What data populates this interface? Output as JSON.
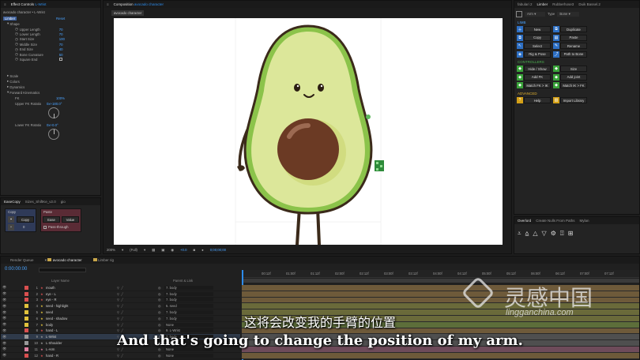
{
  "effect_controls": {
    "tab_label": "Effect Controls",
    "tab_target": "L-Wrist",
    "breadcrumb": "avocado character • L-Wrist",
    "limber_label": "Limber",
    "reset_label": "Reset",
    "shape_label": "Shape",
    "params": [
      {
        "name": "Upper Length",
        "value": "70"
      },
      {
        "name": "Lower Length",
        "value": "70"
      },
      {
        "name": "Start Size",
        "value": "100"
      },
      {
        "name": "Middle Size",
        "value": "70"
      },
      {
        "name": "End Size",
        "value": "40"
      },
      {
        "name": "Bone Curvature",
        "value": "50"
      },
      {
        "name": "Square End",
        "value": ""
      }
    ],
    "sections": [
      "Scale",
      "Colors",
      "Dynamics"
    ],
    "fk_label": "Forward Kinematics",
    "fk_params": [
      {
        "name": "FK",
        "value": "100%"
      },
      {
        "name": "Upper FK Rotatio",
        "value": "0x+180.0°"
      },
      {
        "name": "Lower FK Rotatio",
        "value": "0x+0.0°"
      }
    ]
  },
  "bottom_left": {
    "tabs": [
      "EaseCopy",
      "Sizes_ShiftKe_v2.0",
      "gio"
    ],
    "copy_label": "Copy",
    "copy_btn": "Copy",
    "paste_label": "Paste",
    "ease_btn": "Ease",
    "value_btn": "Value",
    "num": "0",
    "passthrough": "Pass-through"
  },
  "composition": {
    "tab_label": "Composition",
    "tab_target": "avocado character",
    "subtab": "avocado character",
    "zoom": "200%",
    "quality": "(Full)",
    "exposure": "+0.0",
    "timecode": "0;00;00;00"
  },
  "limber": {
    "tabs": [
      "fabulari 2",
      "Limber",
      "Rubberhose3",
      "Duik Bassel.2"
    ],
    "arm_label": "Arm",
    "type_label": "Type",
    "type_value": "Bone",
    "limb_section": "LIMB",
    "buttons": [
      [
        "New",
        "Duplicate"
      ],
      [
        "Copy",
        "Paste"
      ],
      [
        "Select",
        "Rename"
      ],
      [
        "Rig & Pose",
        "Path to Bone"
      ]
    ],
    "controllers_section": "CONTROLLERS",
    "controllers": [
      [
        "Hide / Show",
        "Size"
      ],
      [
        "Add FK",
        "Add joint"
      ],
      [
        "Match FK > IK",
        "Match IK > FK"
      ]
    ],
    "advanced_section": "ADVANCED",
    "advanced": [
      "Help",
      "Import Library"
    ]
  },
  "overlord": {
    "tabs": [
      "Overlord",
      "Create Nulls From Paths",
      "Mylan"
    ]
  },
  "timeline": {
    "tabs": [
      "Render Queue",
      "avocado character",
      "Limber rig"
    ],
    "timecode": "0:00:00:00",
    "header_layer_name": "Layer Name",
    "header_parent": "Parent & Link",
    "ruler": [
      "00:12f",
      "01:00f",
      "01:12f",
      "02:00f",
      "02:12f",
      "03:00f",
      "03:12f",
      "04:00f",
      "04:12f",
      "05:00f",
      "05:12f",
      "06:00f",
      "06:12f",
      "07:00f",
      "07:12f"
    ],
    "layers": [
      {
        "num": "1",
        "name": "mouth",
        "parent": "7. body",
        "color": "#d94f4f"
      },
      {
        "num": "2",
        "name": "eye - L",
        "parent": "7. body",
        "color": "#d94f4f"
      },
      {
        "num": "3",
        "name": "eye - R",
        "parent": "7. body",
        "color": "#d94f4f"
      },
      {
        "num": "4",
        "name": "seed - highlight",
        "parent": "5. seed",
        "color": "#e0c23c"
      },
      {
        "num": "5",
        "name": "seed",
        "parent": "7. body",
        "color": "#e0c23c"
      },
      {
        "num": "6",
        "name": "seed - shadow",
        "parent": "7. body",
        "color": "#e0c23c"
      },
      {
        "num": "7",
        "name": "body",
        "parent": "None",
        "color": "#e0c23c"
      },
      {
        "num": "8",
        "name": "hand - L",
        "parent": "9. L-Wrist",
        "color": "#d94f4f"
      },
      {
        "num": "9",
        "name": "L-Wrist",
        "parent": "7. body",
        "color": "#9a9a9a"
      },
      {
        "num": "10",
        "name": "L-Shoulder",
        "parent": "7. body",
        "color": "#9a9a9a"
      },
      {
        "num": "11",
        "name": "L-Arm",
        "parent": "None",
        "color": "#e07fa0"
      },
      {
        "num": "12",
        "name": "hand - R",
        "parent": "None",
        "color": "#d94f4f"
      }
    ]
  },
  "subtitle": {
    "cn": "这将会改变我的手臂的位置",
    "en": "And that's going to change the position of my arm."
  },
  "watermark": {
    "cn": "灵感中国",
    "url": "lingganchina.com"
  }
}
